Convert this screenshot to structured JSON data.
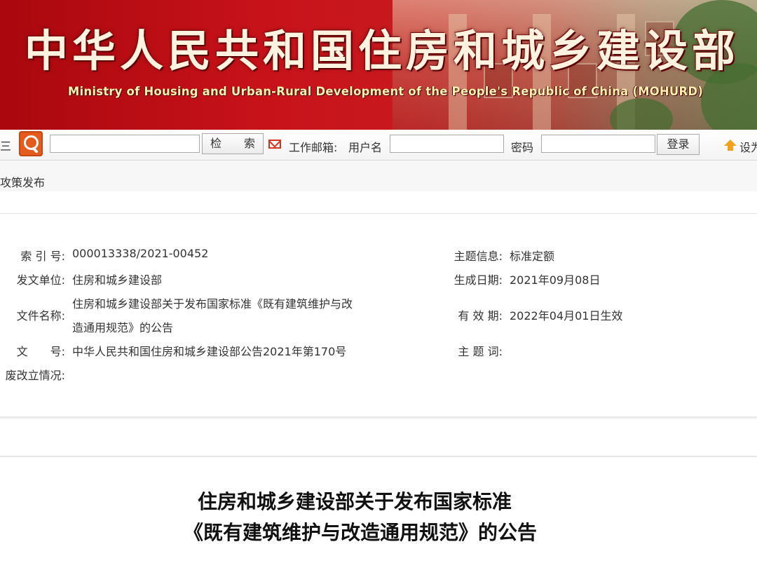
{
  "banner": {
    "title": "中华人民共和国住房和城乡建设部",
    "subtitle": "Ministry of Housing and Urban-Rural Development of the People's Republic of China (MOHURD)"
  },
  "toolbar": {
    "left_fragment": "三",
    "search_button": "检　　索",
    "mail_label": "工作邮箱:",
    "username_label": "用户名",
    "password_label": "密码",
    "login_button": "登录",
    "right_fragment": "设为",
    "search_value": "",
    "username_value": "",
    "password_value": ""
  },
  "breadcrumb": {
    "text": "攻策发布"
  },
  "info": {
    "index_label": "索 引 号:",
    "index_value": "000013338/2021-00452",
    "topic_label": "主题信息:",
    "topic_value": "标准定额",
    "issuer_label": "发文单位:",
    "issuer_value": "住房和城乡建设部",
    "date_label": "生成日期:",
    "date_value": "2021年09月08日",
    "filename_label": "文件名称:",
    "filename_line1": "住房和城乡建设部关于发布国家标准《既有建筑维护与改",
    "filename_line2": "造通用规范》的公告",
    "validity_label": "有 效 期:",
    "validity_value": "2022年04月01日生效",
    "docno_label": "文　　号:",
    "docno_value": "中华人民共和国住房和城乡建设部公告2021年第170号",
    "keywords_label": "主 题 词:",
    "keywords_value": "",
    "status_label": "废改立情况:",
    "status_value": ""
  },
  "article": {
    "title_line1": "住房和城乡建设部关于发布国家标准",
    "title_line2": "《既有建筑维护与改造通用规范》的公告"
  }
}
